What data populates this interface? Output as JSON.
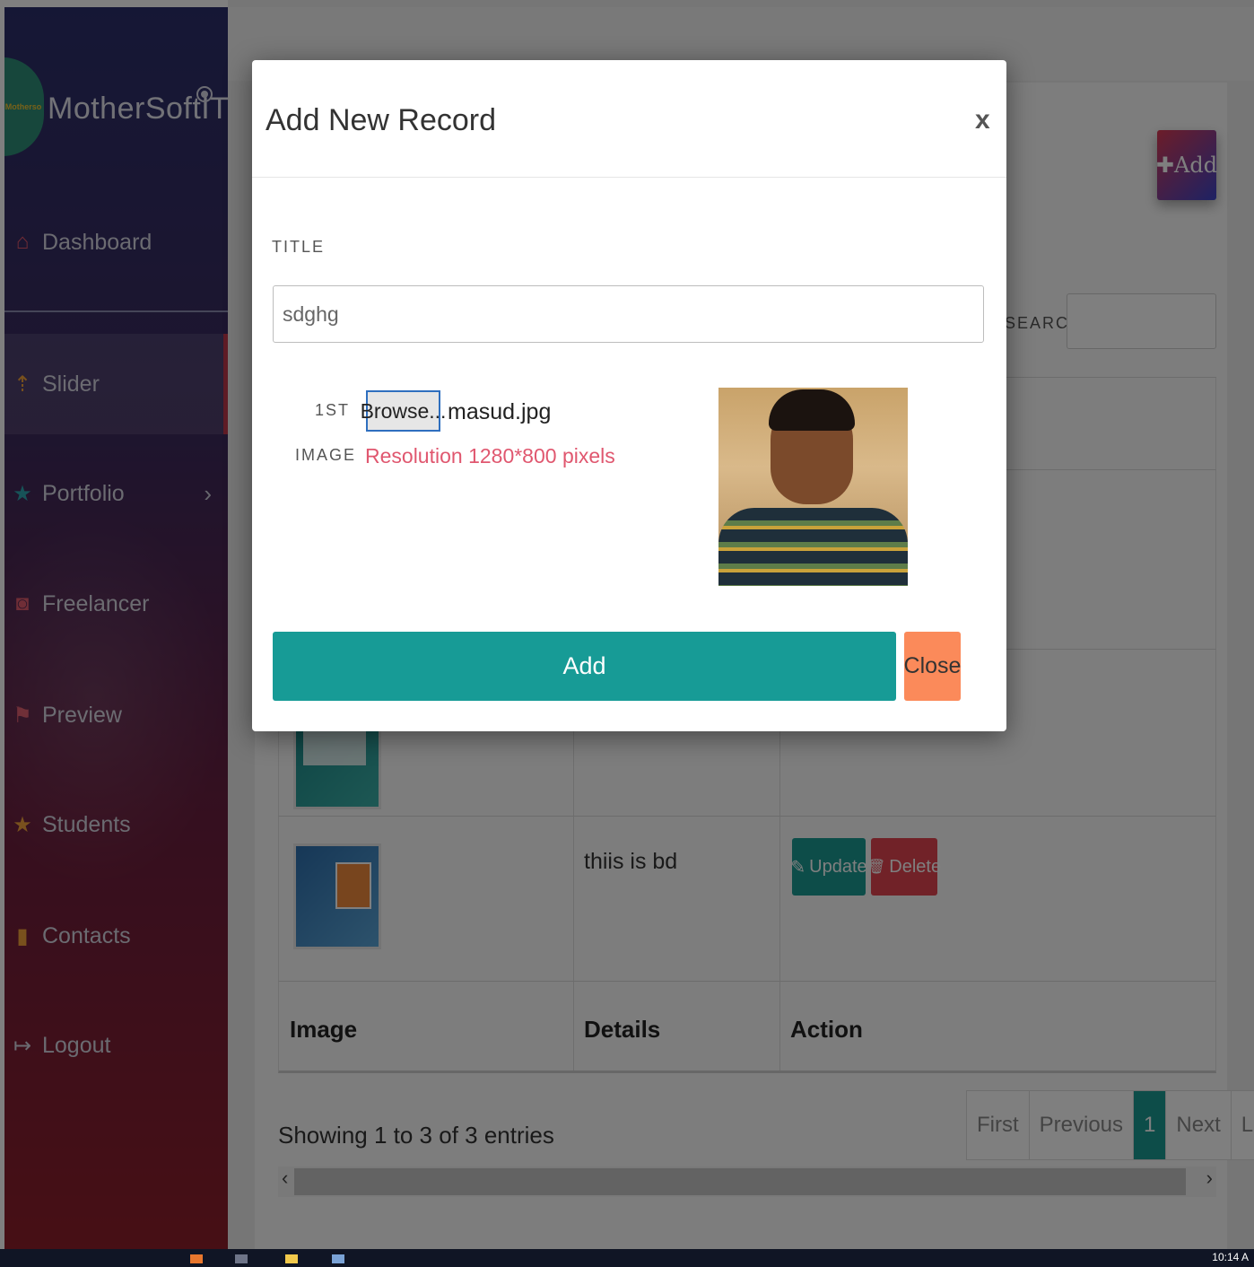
{
  "sidebar": {
    "brand": "MotherSoftIT",
    "logo_text": "Motherso",
    "items": [
      {
        "label": "Dashboard",
        "icon": "home-icon"
      },
      {
        "label": "Slider",
        "icon": "upload-icon"
      },
      {
        "label": "Portfolio",
        "icon": "star-icon"
      },
      {
        "label": "Freelancer",
        "icon": "camera-icon"
      },
      {
        "label": "Preview",
        "icon": "flag-icon"
      },
      {
        "label": "Students",
        "icon": "star-icon"
      },
      {
        "label": "Contacts",
        "icon": "signal-icon"
      },
      {
        "label": "Logout",
        "icon": "logout-icon"
      }
    ],
    "active": "Slider",
    "icon_glyphs": {
      "home": "⌂",
      "upload": "⇡",
      "star": "★",
      "camera": "◙",
      "flag": "⚑",
      "signal": "▮",
      "logout": "↦",
      "chevron": "›"
    }
  },
  "page": {
    "add_button": "✚Add",
    "search_label": "SEARCH:",
    "table": {
      "headers": {
        "image": "Image",
        "details": "Details",
        "action": "Action"
      },
      "rows": [
        {
          "details": "thiis is bd",
          "update": "Update",
          "delete": "Delete"
        }
      ],
      "update_icon": "✎",
      "delete_icon": "🗑"
    },
    "showing": "Showing 1 to 3 of 3 entries",
    "pager": [
      "First",
      "Previous",
      "1",
      "Next",
      "Last"
    ],
    "pager_active": "1",
    "scroll_left": "‹",
    "scroll_right": "›"
  },
  "modal": {
    "title": "Add New Record",
    "close_icon": "x",
    "title_label": "TITLE",
    "title_value": "sdghg",
    "image_label_line1": "1ST",
    "image_label_line2": "IMAGE",
    "browse_label": "Browse...",
    "file_name": "masud.jpg",
    "resolution_note": "Resolution 1280*800 pixels",
    "add_label": "Add",
    "close_label": "Close"
  },
  "taskbar": {
    "clock": "10:14 A"
  },
  "colors": {
    "accent": "#179b96",
    "close_button": "#fb8a5a",
    "delete_button": "#e24551",
    "resolution_text": "#e0576f"
  }
}
